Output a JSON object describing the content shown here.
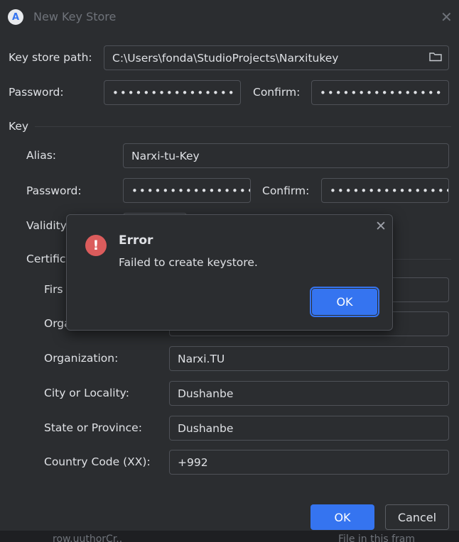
{
  "window": {
    "title": "New Key Store",
    "close_glyph": "✕",
    "app_icon_letter": "A"
  },
  "keystore": {
    "path_label": "Key store path:",
    "path_value": "C:\\Users\\fonda\\StudioProjects\\Narxitukey",
    "password_label": "Password:",
    "password_value": "••••••••••••••••",
    "confirm_label": "Confirm:",
    "confirm_value": "••••••••••••••••"
  },
  "key": {
    "section_label": "Key",
    "alias_label": "Alias:",
    "alias_value": "Narxi-tu-Key",
    "password_label": "Password:",
    "password_value": "••••••••••••••••",
    "confirm_label": "Confirm:",
    "confirm_value": "••••••••••••••••",
    "validity_label": "Validity",
    "certificate_label": "Certific",
    "first_label": "Firs",
    "org_unit_label": "Orga",
    "organization_label": "Organization:",
    "organization_value": "Narxi.TU",
    "city_label": "City or Locality:",
    "city_value": "Dushanbe",
    "state_label": "State or Province:",
    "state_value": "Dushanbe",
    "country_label": "Country Code (XX):",
    "country_value": "+992"
  },
  "buttons": {
    "ok": "OK",
    "cancel": "Cancel"
  },
  "error_popup": {
    "title": "Error",
    "message": "Failed to create keystore.",
    "ok": "OK",
    "icon_glyph": "!",
    "close_glyph": "✕"
  },
  "background_strip": {
    "left_text": "row.uuthorCr..",
    "right_text": "File   in this   fram"
  },
  "colors": {
    "accent": "#3574f0",
    "error": "#db5c5c",
    "background": "#2b2d30"
  }
}
